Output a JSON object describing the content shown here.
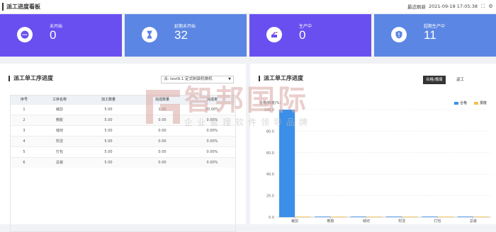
{
  "header": {
    "title": "派工进度看板",
    "refresh_label": "最近刷新",
    "timestamp": "2021-09-18 17:05:38"
  },
  "cards": [
    {
      "label": "未开始",
      "value": "0",
      "color": "#6a4ff0",
      "icon": "dots-icon"
    },
    {
      "label": "延期未开始",
      "value": "32",
      "color": "#5b86e3",
      "icon": "hourglass-icon"
    },
    {
      "label": "生产中",
      "value": "0",
      "color": "#6a4ff0",
      "icon": "production-icon"
    },
    {
      "label": "超期生产中",
      "value": "11",
      "color": "#5b86e3",
      "icon": "shield-alert-icon"
    }
  ],
  "left_panel": {
    "title": "派工单工序进度",
    "select_value": "派: test9.1 定式制袋机做机"
  },
  "table": {
    "headers": [
      "序号",
      "工序名称",
      "加工数量",
      "完成数量",
      "完成率"
    ],
    "rows": [
      [
        "1",
        "裁剪",
        "5.00",
        "1.00",
        "20.00%"
      ],
      [
        "2",
        "敷胶",
        "5.00",
        "0.00",
        "0.00%"
      ],
      [
        "3",
        "缝纫",
        "5.00",
        "0.00",
        "0.00%"
      ],
      [
        "4",
        "熨烫",
        "5.00",
        "0.00",
        "0.00%"
      ],
      [
        "5",
        "打包",
        "5.00",
        "0.00",
        "0.00%"
      ],
      [
        "6",
        "总装",
        "5.00",
        "0.00",
        "0.00%"
      ]
    ]
  },
  "right_panel": {
    "title": "派工单工序进度",
    "tabs": [
      "合格/报废",
      "返工"
    ],
    "active_tab": 0
  },
  "watermark": {
    "big": "智邦国际",
    "small": "企业管理软件领导品牌"
  },
  "chart_data": {
    "type": "bar",
    "ylabel": "合格/报废(%)",
    "categories": [
      "裁剪",
      "敷胶",
      "缝纫",
      "熨烫",
      "打包",
      "总装"
    ],
    "series": [
      {
        "name": "合格",
        "values": [
          100,
          0,
          0,
          0,
          0,
          0
        ],
        "color": "#3b8fe8"
      },
      {
        "name": "报废",
        "values": [
          0,
          0,
          0,
          0,
          0,
          0
        ],
        "color": "#f2c14e"
      }
    ],
    "yticks": [
      "0.0",
      "20.0",
      "40.0",
      "60.0",
      "80.0",
      "100.0"
    ],
    "ylim": [
      0,
      100
    ],
    "grid": true,
    "legend_position": "top-right"
  }
}
